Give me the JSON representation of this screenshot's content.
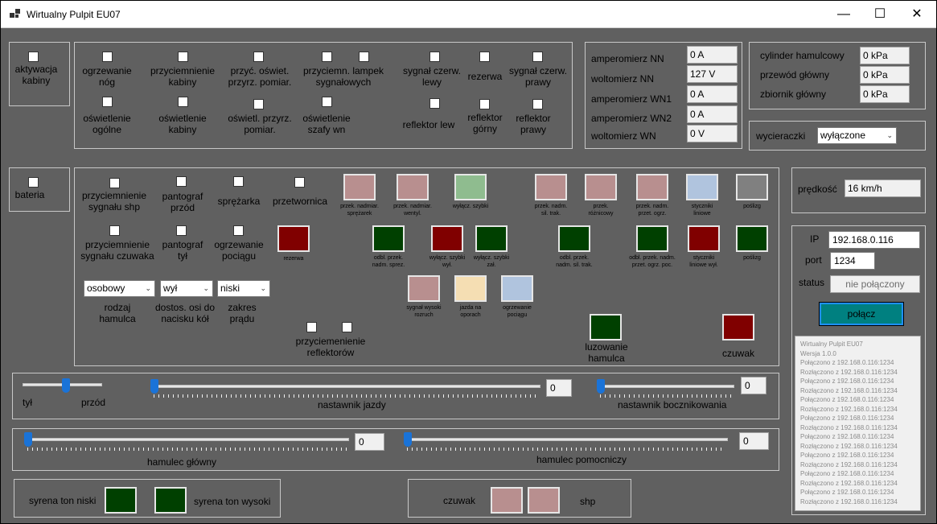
{
  "window": {
    "title": "Wirtualny Pulpit EU07",
    "minimize": "—",
    "maximize": "☐",
    "close": "✕"
  },
  "left_controls": {
    "cabin": "aktywacja\nkabiny",
    "battery": "bateria"
  },
  "heating_panel": {
    "ogrzewanie_nog": "ogrzewanie\nnóg",
    "przyciemnienie_kabiny": "przyciemnienie\nkabiny",
    "przyciemnienie_oswietlenia": "przyć. oświet.\nprzyrz. pomiar.",
    "przyciemnienie_lampek": "przyciemn. lampek\nsygnałowych",
    "sygnal_lewy": "sygnał czerw.\nlewy",
    "rezerwa": "rezerwa",
    "sygnal_prawy": "sygnał czerw.\nprawy",
    "oswietlenie_ogolne": "oświetlenie\nogólne",
    "oswietlenie_kabiny": "oświetlenie\nkabiny",
    "oswietlenie_przyrz": "oświetl. przyrz.\npomiar.",
    "oswietlenie_szafy": "oświetlenie\nszafy wn",
    "reflektor_lew": "reflektor lew",
    "reflektor_gorny": "reflektor\ngórny",
    "reflektor_prawy": "reflektor\nprawy"
  },
  "meters": [
    {
      "label": "amperomierz NN",
      "value": "0 A"
    },
    {
      "label": "woltomierz NN",
      "value": "127 V"
    },
    {
      "label": "amperomierz WN1",
      "value": "0 A"
    },
    {
      "label": "amperomierz WN2",
      "value": "0 A"
    },
    {
      "label": "woltomierz WN",
      "value": "0 V"
    }
  ],
  "pressures": [
    {
      "label": "cylinder hamulcowy",
      "value": "0 kPa"
    },
    {
      "label": "przewód główny",
      "value": "0  kPa"
    },
    {
      "label": "zbiornik główny",
      "value": "0 kPa"
    }
  ],
  "wipers": {
    "label": "wycieraczki",
    "value": "wyłączone"
  },
  "speed": {
    "label": "prędkość",
    "value": "16 km/h"
  },
  "connection": {
    "ip_label": "IP",
    "ip": "192.168.0.116",
    "port_label": "port",
    "port": "1234",
    "status_label": "status",
    "status": "nie połączony",
    "connect": "połącz"
  },
  "log": [
    "Wirtualny Pulpit EU07",
    "Wersja 1.0.0",
    "Połączono z 192.168.0.116:1234",
    "Rozłączono z 192.168.0.116:1234",
    "Połączono z 192.168.0.116:1234",
    "Rozłączono z 192.168.0.116:1234",
    "Połączono z 192.168.0.116:1234",
    "Rozłączono z 192.168.0.116:1234",
    "Połączono z 192.168.0.116:1234",
    "Rozłączono z 192.168.0.116:1234",
    "Połączono z 192.168.0.116:1234",
    "Rozłączono z 192.168.0.116:1234",
    "Połączono z 192.168.0.116:1234",
    "Rozłączono z 192.168.0.116:1234",
    "Połączono z 192.168.0.116:1234",
    "Rozłączono z 192.168.0.116:1234",
    "Połączono z 192.168.0.116:1234",
    "Rozłączono z 192.168.0.116:1234"
  ],
  "main_panel": {
    "przyciemnienie_shp": "przyciemnienie\nsygnału shp",
    "pantograf_przod": "pantograf\nprzód",
    "sprezarka": "sprężarka",
    "przetwornica": "przetwornica",
    "przyciemnienie_czuwaka": "przyciemnienie\nsygnału czuwaka",
    "pantograf_tyl": "pantograf\ntył",
    "ogrzewanie_pociagu": "ogrzewanie\npociągu",
    "rodzaj_hamulca_label": "rodzaj\nhamulca",
    "rodzaj_hamulca": "osobowy",
    "dostos_osi_label": "dostos. osi do\nnacisku kół",
    "dostos_osi": "wył",
    "zakres_pradu_label": "zakres\nprądu",
    "zakres_pradu": "niski",
    "przyciemnienie_reflektorow": "przyciemenienie\nreflektorów",
    "rezerwa": "rezerwa",
    "luzowanie": "luzowanie\nhamulca",
    "czuwak": "czuwak"
  },
  "indicators": [
    {
      "label": "przek. nadmiar.\nsprężarek",
      "color": "#b88f8f"
    },
    {
      "label": "przek. nadmiar.\nwentyl.",
      "color": "#b88f8f"
    },
    {
      "label": "wyłącz. szybki",
      "color": "#8fbc8f"
    },
    {
      "label": "przek. nadm.\nsil. trak.",
      "color": "#b88f8f"
    },
    {
      "label": "przek.\nróżnicowy",
      "color": "#b88f8f"
    },
    {
      "label": "przek. nadm.\nprzet. ogrz.",
      "color": "#b88f8f"
    },
    {
      "label": "styczniki\nliniowe",
      "color": "#b0c4de"
    },
    {
      "label": "poślizg",
      "color": "#808080"
    },
    {
      "label": "odbl. przek.\nnadm. sprez.",
      "color": "#004000"
    },
    {
      "label": "wyłącz. szybki\nwył.",
      "color": "#800000"
    },
    {
      "label": "wyłącz. szybki\nzał.",
      "color": "#004000"
    },
    {
      "label": "odbl. przek.\nnadm. sil. trak.",
      "color": "#004000"
    },
    {
      "label": "odbl. przek. nadm.\nprzet. ogrz. poc.",
      "color": "#004000"
    },
    {
      "label": "styczniki\nliniowe wył.",
      "color": "#800000"
    },
    {
      "label": "poślizg",
      "color": "#004000"
    },
    {
      "label": "sygnał wysoki\nrozruch",
      "color": "#b88f8f"
    },
    {
      "label": "jazda na\noporach",
      "color": "#f5deb3"
    },
    {
      "label": "ogrzewanie\npociągu",
      "color": "#b0c4de"
    }
  ],
  "sliders": {
    "kierunek": {
      "back": "tył",
      "forward": "przód",
      "position": 0.55
    },
    "jazda": {
      "label": "nastawnik jazdy",
      "value": "0"
    },
    "bocznik": {
      "label": "nastawnik bocznikowania",
      "value": "0"
    },
    "glowny": {
      "label": "hamulec główny",
      "value": "0"
    },
    "pomocniczy": {
      "label": "hamulec pomocniczy",
      "value": "0"
    }
  },
  "sirens": {
    "low": "syrena ton niski",
    "high": "syrena ton wysoki"
  },
  "safety": {
    "czuwak": "czuwak",
    "shp": "shp"
  },
  "colors": {
    "red_on": "#800000",
    "green_on": "#004000",
    "teal": "#008080"
  }
}
